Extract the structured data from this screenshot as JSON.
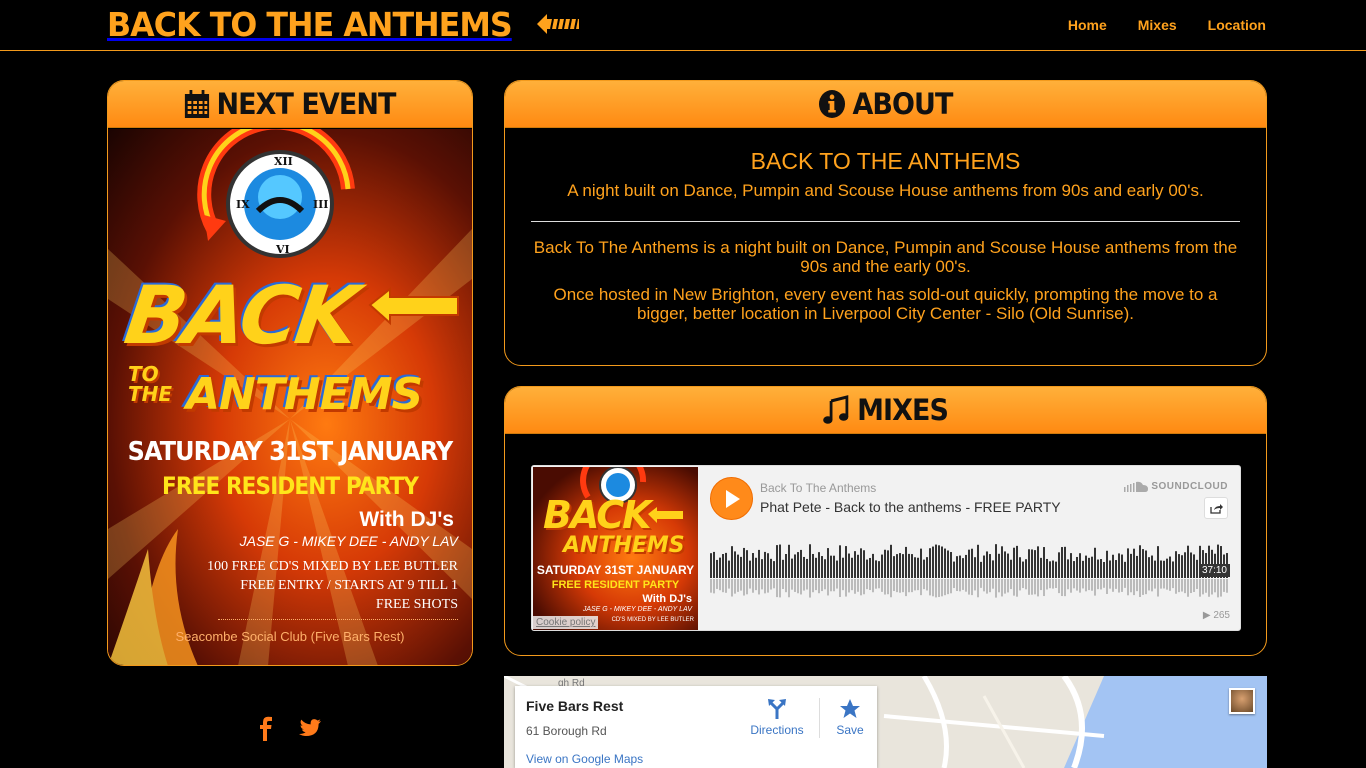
{
  "header": {
    "brand": "BACK TO THE ANTHEMS",
    "nav": [
      "Home",
      "Mixes",
      "Location"
    ]
  },
  "event": {
    "heading": "NEXT EVENT",
    "poster": {
      "back": "BACK",
      "to": "TO",
      "the": "THE",
      "anthems": "ANTHEMS",
      "date": "SATURDAY 31ST JANUARY",
      "party": "FREE RESIDENT PARTY",
      "with": "With DJ's",
      "djs": "JASE G - MIKEY DEE - ANDY LAV",
      "line1": "100 FREE CD'S MIXED BY LEE BUTLER",
      "line2": "FREE ENTRY / STARTS AT 9 TILL 1",
      "line3": "FREE SHOTS",
      "venue": "Seacombe Social Club (Five Bars Rest)"
    }
  },
  "about": {
    "heading": "ABOUT",
    "title": "BACK TO THE ANTHEMS",
    "subtitle": "A night built on Dance, Pumpin and Scouse House anthems from 90s and early 00's.",
    "p1": "Back To The Anthems is a night built on Dance, Pumpin and Scouse House anthems from the 90s and the early 00's.",
    "p2": "Once hosted in New Brighton, every event has sold-out quickly, prompting the move to a bigger, better location in Liverpool City Center - Silo (Old Sunrise)."
  },
  "mixes": {
    "heading": "MIXES",
    "player": {
      "user": "Back To The Anthems",
      "track": "Phat Pete - Back to the anthems - FREE PARTY",
      "brand": "SOUNDCLOUD",
      "duration": "37:10",
      "plays": "265",
      "cookie": "Cookie policy",
      "art": {
        "back": "BACK",
        "anthems": "ANTHEMS",
        "to_the": "TO THE",
        "date": "SATURDAY 31ST JANUARY",
        "party": "FREE RESIDENT PARTY",
        "with": "With DJ's",
        "djs": "JASE G - MIKEY DEE - ANDY LAV",
        "line1": "CD'S MIXED BY LEE BUTLER"
      }
    }
  },
  "map": {
    "place": "Five Bars Rest",
    "address": "61 Borough Rd",
    "link": "View on Google Maps",
    "directions": "Directions",
    "save": "Save",
    "road_fragment": "gh Rd"
  },
  "colors": {
    "accent": "#ffa21d",
    "header_gradient_top": "#ffb03a",
    "header_gradient_bottom": "#ff8a12",
    "soundcloud": "#ff8a1a"
  }
}
